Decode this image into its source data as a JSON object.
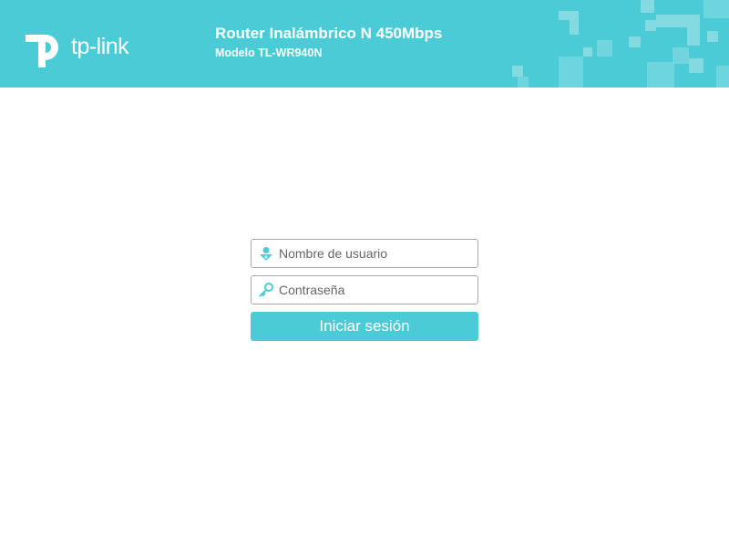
{
  "header": {
    "logo_text": "tp-link",
    "product_title": "Router Inalámbrico N 450Mbps",
    "product_model": "Modelo TL-WR940N",
    "background_color": "#4acbd6"
  },
  "login": {
    "username_placeholder": "Nombre de usuario",
    "username_icon": "user-icon",
    "password_placeholder": "Contraseña",
    "password_icon": "key-icon",
    "submit_label": "Iniciar sesión",
    "accent_color": "#4acbd6"
  }
}
